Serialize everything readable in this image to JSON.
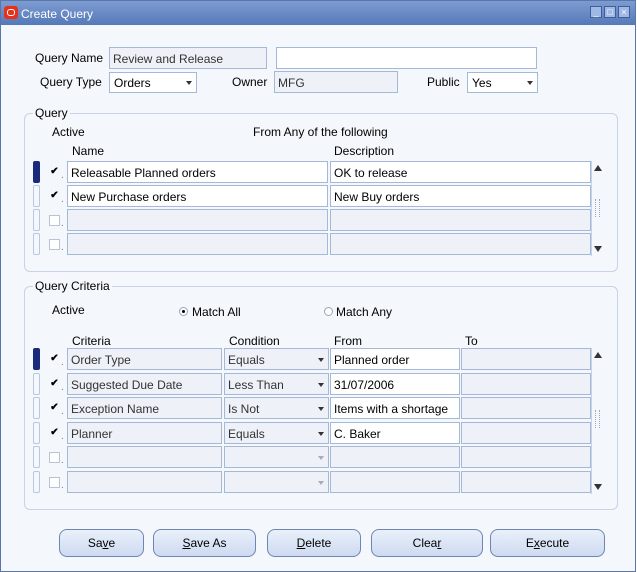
{
  "window": {
    "title": "Create Query"
  },
  "header": {
    "query_name_label": "Query Name",
    "query_name_value": "Review and Release",
    "query_desc_value": "",
    "query_type_label": "Query Type",
    "query_type_value": "Orders",
    "owner_label": "Owner",
    "owner_value": "MFG",
    "public_label": "Public",
    "public_value": "Yes"
  },
  "query": {
    "title": "Query",
    "active_label": "Active",
    "from_any_label": "From Any of the following",
    "col_name": "Name",
    "col_description": "Description",
    "rows": [
      {
        "name": "Releasable Planned orders",
        "description": "OK to release",
        "checked": true,
        "current": true
      },
      {
        "name": "New Purchase orders",
        "description": "New Buy orders",
        "checked": true,
        "current": false
      },
      {
        "name": "",
        "description": "",
        "checked": false,
        "current": false
      },
      {
        "name": "",
        "description": "",
        "checked": false,
        "current": false
      }
    ]
  },
  "criteria": {
    "title": "Query Criteria",
    "active_label": "Active",
    "match_all_label": "Match All",
    "match_any_label": "Match Any",
    "match_selected": "all",
    "col_criteria": "Criteria",
    "col_condition": "Condition",
    "col_from": "From",
    "col_to": "To",
    "rows": [
      {
        "criteria": "Order Type",
        "condition": "Equals",
        "from": "Planned order",
        "to": "",
        "checked": true,
        "current": true
      },
      {
        "criteria": "Suggested Due Date",
        "condition": "Less Than",
        "from": "31/07/2006",
        "to": "",
        "checked": true,
        "current": false
      },
      {
        "criteria": "Exception Name",
        "condition": "Is Not",
        "from": "Items with a shortage",
        "to": "",
        "checked": true,
        "current": false
      },
      {
        "criteria": "Planner",
        "condition": "Equals",
        "from": "C. Baker",
        "to": "",
        "checked": true,
        "current": false
      },
      {
        "criteria": "",
        "condition": "",
        "from": "",
        "to": "",
        "checked": false,
        "current": false
      },
      {
        "criteria": "",
        "condition": "",
        "from": "",
        "to": "",
        "checked": false,
        "current": false
      }
    ]
  },
  "buttons": {
    "save": {
      "pre": "Sa",
      "ul": "v",
      "post": "e"
    },
    "save_as": {
      "pre": "",
      "ul": "S",
      "post": "ave As"
    },
    "delete": {
      "pre": "",
      "ul": "D",
      "post": "elete"
    },
    "clear": {
      "pre": "Clea",
      "ul": "r",
      "post": ""
    },
    "execute": {
      "pre": "E",
      "ul": "x",
      "post": "ecute"
    }
  },
  "colors": {
    "titlebar": "#5579b8",
    "marker_active": "#1a2a7a",
    "border": "#a5b8d6"
  }
}
